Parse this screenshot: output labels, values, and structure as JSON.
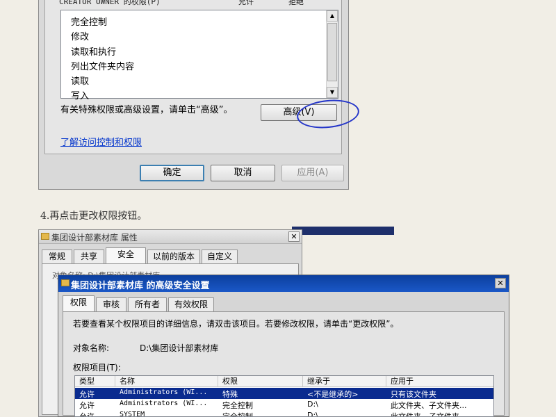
{
  "top_dialog": {
    "perm_header": {
      "label": "CREATOR OWNER 的权限(P)",
      "allow": "允许",
      "deny": "拒绝"
    },
    "perm_items": [
      "完全控制",
      "修改",
      "读取和执行",
      "列出文件夹内容",
      "读取",
      "写入"
    ],
    "advanced_text": "有关特殊权限或高级设置，请单击“高级”。",
    "advanced_button": "高级(V)",
    "link": "了解访问控制和权限",
    "ok_button": "确定",
    "cancel_button": "取消",
    "apply_button": "应用(A)"
  },
  "step_label": "4.再点击更改权限按钮。",
  "properties_dialog": {
    "title": "集团设计部素材库 属性",
    "tabs": [
      "常规",
      "共享",
      "安全",
      "以前的版本",
      "自定义"
    ],
    "active_tab": "安全",
    "ghost_text": "对象名称:   D:\\集团设计部素材库"
  },
  "advanced_dialog": {
    "title": "集团设计部素材库 的高级安全设置",
    "tabs": [
      "权限",
      "审核",
      "所有者",
      "有效权限"
    ],
    "active_tab": "权限",
    "info_text": "若要查看某个权限项目的详细信息，请双击该项目。若要修改权限，请单击“更改权限”。",
    "object_name_label": "对象名称:",
    "object_name_value": "D:\\集团设计部素材库",
    "entries_label": "权限项目(T):",
    "columns": [
      "类型",
      "名称",
      "权限",
      "继承于",
      "应用于"
    ],
    "rows": [
      {
        "type": "允许",
        "name": "Administrators (WI...",
        "permission": "特殊",
        "inherited": "<不是继承的>",
        "applies": "只有该文件夹"
      },
      {
        "type": "允许",
        "name": "Administrators (WI...",
        "permission": "完全控制",
        "inherited": "D:\\",
        "applies": "此文件夹、子文件夹..."
      },
      {
        "type": "允许",
        "name": "SYSTEM",
        "permission": "完全控制",
        "inherited": "D:\\",
        "applies": "此文件夹、子文件夹..."
      }
    ]
  },
  "colors": {
    "accent_circle": "#2536c9",
    "title_bar": "#0c3f9e",
    "selection": "#0a2b8f",
    "link": "#0033cc"
  }
}
